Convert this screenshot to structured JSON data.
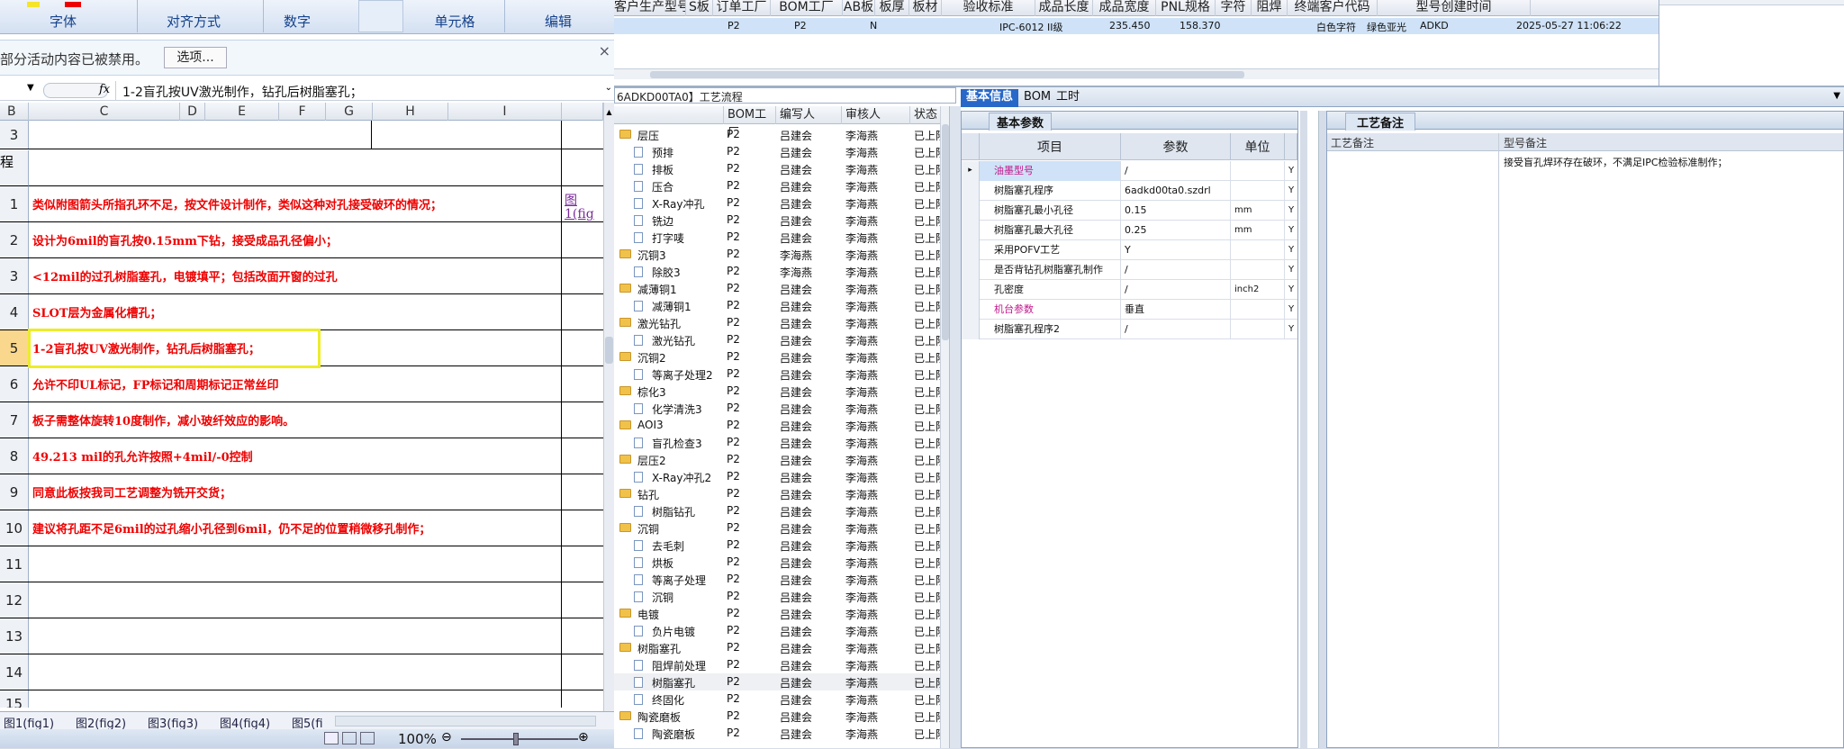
{
  "excel": {
    "ribbon_groups": [
      "字体",
      "对齐方式",
      "数字",
      "单元格",
      "编辑"
    ],
    "message_bar": {
      "text": "部分活动内容已被禁用。",
      "button": "选项..."
    },
    "formula_bar": {
      "fx": "fx",
      "content": "1-2盲孔按UV激光制作，钻孔后树脂塞孔；"
    },
    "columns": [
      "B",
      "C",
      "D",
      "E",
      "F",
      "G",
      "H",
      "I"
    ],
    "row_header_partial": "程",
    "rows": [
      {
        "num": "3",
        "text": ""
      },
      {
        "num": "1",
        "text": "类似附图箭头所指孔环不足，按文件设计制作，类似这种对孔接受破环的情况；"
      },
      {
        "num": "2",
        "text": "设计为6mil的盲孔按0.15mm下钻，接受成品孔径偏小；"
      },
      {
        "num": "3",
        "text": "<12mil的过孔树脂塞孔，电镀填平；包括改面开窗的过孔"
      },
      {
        "num": "4",
        "text": "SLOT层为金属化槽孔；"
      },
      {
        "num": "5",
        "text": "1-2盲孔按UV激光制作，钻孔后树脂塞孔；"
      },
      {
        "num": "6",
        "text": "允许不印UL标记，FP标记和周期标记正常丝印"
      },
      {
        "num": "7",
        "text": "板子需整体旋转10度制作，减小玻纤效应的影响。"
      },
      {
        "num": "8",
        "text": "49.213 mil的孔允许按照+4mil/-0控制"
      },
      {
        "num": "9",
        "text": "同意此板按我司工艺调整为铣开交货；"
      },
      {
        "num": "10",
        "text": "建议将孔距不足6mil的过孔缩小孔径到6mil，仍不足的位置稍微移孔制作；"
      },
      {
        "num": "11",
        "text": ""
      },
      {
        "num": "12",
        "text": ""
      },
      {
        "num": "13",
        "text": ""
      },
      {
        "num": "14",
        "text": ""
      },
      {
        "num": "15",
        "text": ""
      }
    ],
    "link_text_1": "图",
    "link_text_2": "1(fig",
    "sheet_tabs": [
      "图1(fig1)",
      "图2(fig2)",
      "图3(fig3)",
      "图4(fig4)",
      "图5(fi"
    ],
    "zoom": "100%"
  },
  "top_grid": {
    "headers": [
      "客户生产型号",
      "S板",
      "订单工厂",
      "BOM工厂",
      "AB板",
      "板厚",
      "板材",
      "验收标准",
      "成品长度",
      "成品宽度",
      "PNL规格",
      "字符",
      "阻焊",
      "终端客户代码",
      "型号创建时间"
    ],
    "row": {
      "order_factory": "P2",
      "bom_factory": "P2",
      "ab": "N",
      "standard": "IPC-6012 II级",
      "length": "235.450",
      "width": "158.370",
      "char": "白色字符",
      "mask": "绿色亚光",
      "customer": "ADKD",
      "created": "2025-05-27 11:06:22"
    }
  },
  "workflow_title": "6ADKD00TA0】工艺流程",
  "tree": {
    "headers": [
      "",
      "BOM工厂",
      "编写人",
      "审核人",
      "状态"
    ],
    "rows": [
      {
        "type": "folder",
        "label": "层压",
        "f": "P2",
        "w": "吕建会",
        "r": "李海燕",
        "s": "已上阶"
      },
      {
        "type": "doc",
        "label": "预排",
        "f": "P2",
        "w": "吕建会",
        "r": "李海燕",
        "s": "已上阶"
      },
      {
        "type": "doc",
        "label": "排板",
        "f": "P2",
        "w": "吕建会",
        "r": "李海燕",
        "s": "已上阶"
      },
      {
        "type": "doc",
        "label": "压合",
        "f": "P2",
        "w": "吕建会",
        "r": "李海燕",
        "s": "已上阶"
      },
      {
        "type": "doc",
        "label": "X-Ray冲孔",
        "f": "P2",
        "w": "吕建会",
        "r": "李海燕",
        "s": "已上阶"
      },
      {
        "type": "doc",
        "label": "铣边",
        "f": "P2",
        "w": "吕建会",
        "r": "李海燕",
        "s": "已上阶"
      },
      {
        "type": "doc",
        "label": "打字唛",
        "f": "P2",
        "w": "吕建会",
        "r": "李海燕",
        "s": "已上阶"
      },
      {
        "type": "folder",
        "label": "沉铜3",
        "f": "P2",
        "w": "李海燕",
        "r": "李海燕",
        "s": "已上阶"
      },
      {
        "type": "doc",
        "label": "除胶3",
        "f": "P2",
        "w": "李海燕",
        "r": "李海燕",
        "s": "已上阶"
      },
      {
        "type": "folder",
        "label": "减薄铜1",
        "f": "P2",
        "w": "吕建会",
        "r": "李海燕",
        "s": "已上阶"
      },
      {
        "type": "doc",
        "label": "减薄铜1",
        "f": "P2",
        "w": "吕建会",
        "r": "李海燕",
        "s": "已上阶"
      },
      {
        "type": "folder",
        "label": "激光钻孔",
        "f": "P2",
        "w": "吕建会",
        "r": "李海燕",
        "s": "已上阶"
      },
      {
        "type": "doc",
        "label": "激光钻孔",
        "f": "P2",
        "w": "吕建会",
        "r": "李海燕",
        "s": "已上阶"
      },
      {
        "type": "folder",
        "label": "沉铜2",
        "f": "P2",
        "w": "吕建会",
        "r": "李海燕",
        "s": "已上阶"
      },
      {
        "type": "doc",
        "label": "等离子处理2",
        "f": "P2",
        "w": "吕建会",
        "r": "李海燕",
        "s": "已上阶"
      },
      {
        "type": "folder",
        "label": "棕化3",
        "f": "P2",
        "w": "吕建会",
        "r": "李海燕",
        "s": "已上阶"
      },
      {
        "type": "doc",
        "label": "化学清洗3",
        "f": "P2",
        "w": "吕建会",
        "r": "李海燕",
        "s": "已上阶"
      },
      {
        "type": "folder",
        "label": "AOI3",
        "f": "P2",
        "w": "吕建会",
        "r": "李海燕",
        "s": "已上阶"
      },
      {
        "type": "doc",
        "label": "盲孔检查3",
        "f": "P2",
        "w": "吕建会",
        "r": "李海燕",
        "s": "已上阶"
      },
      {
        "type": "folder",
        "label": "层压2",
        "f": "P2",
        "w": "吕建会",
        "r": "李海燕",
        "s": "已上阶"
      },
      {
        "type": "doc",
        "label": "X-Ray冲孔2",
        "f": "P2",
        "w": "吕建会",
        "r": "李海燕",
        "s": "已上阶"
      },
      {
        "type": "folder",
        "label": "钻孔",
        "f": "P2",
        "w": "吕建会",
        "r": "李海燕",
        "s": "已上阶"
      },
      {
        "type": "doc",
        "label": "树脂钻孔",
        "f": "P2",
        "w": "吕建会",
        "r": "李海燕",
        "s": "已上阶"
      },
      {
        "type": "folder",
        "label": "沉铜",
        "f": "P2",
        "w": "吕建会",
        "r": "李海燕",
        "s": "已上阶"
      },
      {
        "type": "doc",
        "label": "去毛刺",
        "f": "P2",
        "w": "吕建会",
        "r": "李海燕",
        "s": "已上阶"
      },
      {
        "type": "doc",
        "label": "烘板",
        "f": "P2",
        "w": "吕建会",
        "r": "李海燕",
        "s": "已上阶"
      },
      {
        "type": "doc",
        "label": "等离子处理",
        "f": "P2",
        "w": "吕建会",
        "r": "李海燕",
        "s": "已上阶"
      },
      {
        "type": "doc",
        "label": "沉铜",
        "f": "P2",
        "w": "吕建会",
        "r": "李海燕",
        "s": "已上阶"
      },
      {
        "type": "folder",
        "label": "电镀",
        "f": "P2",
        "w": "吕建会",
        "r": "李海燕",
        "s": "已上阶"
      },
      {
        "type": "doc",
        "label": "负片电镀",
        "f": "P2",
        "w": "吕建会",
        "r": "李海燕",
        "s": "已上阶"
      },
      {
        "type": "folder",
        "label": "树脂塞孔",
        "f": "P2",
        "w": "吕建会",
        "r": "李海燕",
        "s": "已上阶"
      },
      {
        "type": "doc",
        "label": "阻焊前处理",
        "f": "P2",
        "w": "吕建会",
        "r": "李海燕",
        "s": "已上阶"
      },
      {
        "type": "doc",
        "label": "树脂塞孔",
        "f": "P2",
        "w": "吕建会",
        "r": "李海燕",
        "s": "已上阶"
      },
      {
        "type": "doc",
        "label": "终固化",
        "f": "P2",
        "w": "吕建会",
        "r": "李海燕",
        "s": "已上阶"
      },
      {
        "type": "folder",
        "label": "陶瓷磨板",
        "f": "P2",
        "w": "吕建会",
        "r": "李海燕",
        "s": "已上阶"
      },
      {
        "type": "doc",
        "label": "陶瓷磨板",
        "f": "P2",
        "w": "吕建会",
        "r": "李海燕",
        "s": "已上阶"
      }
    ]
  },
  "info_tabs": [
    "基本信息",
    "BOM",
    "工时"
  ],
  "basic_params": {
    "title": "基本参数",
    "headers": [
      "项目",
      "参数",
      "单位"
    ],
    "rows": [
      {
        "item": "油墨型号",
        "value": "/",
        "unit": "",
        "flag": "Y",
        "pink": true
      },
      {
        "item": "树脂塞孔程序",
        "value": "6adkd00ta0.szdrl",
        "unit": "",
        "flag": "Y",
        "pink": false
      },
      {
        "item": "树脂塞孔最小孔径",
        "value": "0.15",
        "unit": "mm",
        "flag": "Y",
        "pink": false
      },
      {
        "item": "树脂塞孔最大孔径",
        "value": "0.25",
        "unit": "mm",
        "flag": "Y",
        "pink": false
      },
      {
        "item": "采用POFV工艺",
        "value": "Y",
        "unit": "",
        "flag": "Y",
        "pink": false
      },
      {
        "item": "是否背钻孔树脂塞孔制作",
        "value": "/",
        "unit": "",
        "flag": "Y",
        "pink": false
      },
      {
        "item": "孔密度",
        "value": "/",
        "unit": "inch2",
        "flag": "Y",
        "pink": false
      },
      {
        "item": "机台参数",
        "value": "垂直",
        "unit": "",
        "flag": "Y",
        "pink": true
      },
      {
        "item": "树脂塞孔程序2",
        "value": "/",
        "unit": "",
        "flag": "Y",
        "pink": false
      }
    ]
  },
  "process_note": {
    "title": "工艺备注",
    "col1": "工艺备注",
    "col2": "型号备注",
    "model_note": "接受盲孔焊环存在破环，不满足IPC检验标准制作；"
  }
}
